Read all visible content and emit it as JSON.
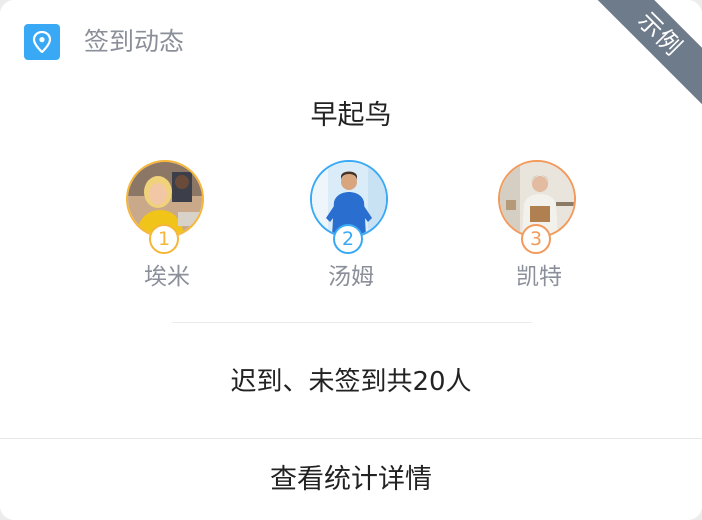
{
  "header": {
    "icon": "location-pin-icon",
    "title": "签到动态",
    "ribbon": "示例"
  },
  "early_bird": {
    "title": "早起鸟",
    "people": [
      {
        "rank": "1",
        "name": "埃米",
        "color": "#f5b63a"
      },
      {
        "rank": "2",
        "name": "汤姆",
        "color": "#3aa9f5"
      },
      {
        "rank": "3",
        "name": "凯特",
        "color": "#f29a5c"
      }
    ]
  },
  "summary": {
    "text": "迟到、未签到共20人"
  },
  "footer": {
    "button_label": "查看统计详情"
  },
  "colors": {
    "accent": "#3aa9f5",
    "ribbon": "#6e7b8b"
  }
}
